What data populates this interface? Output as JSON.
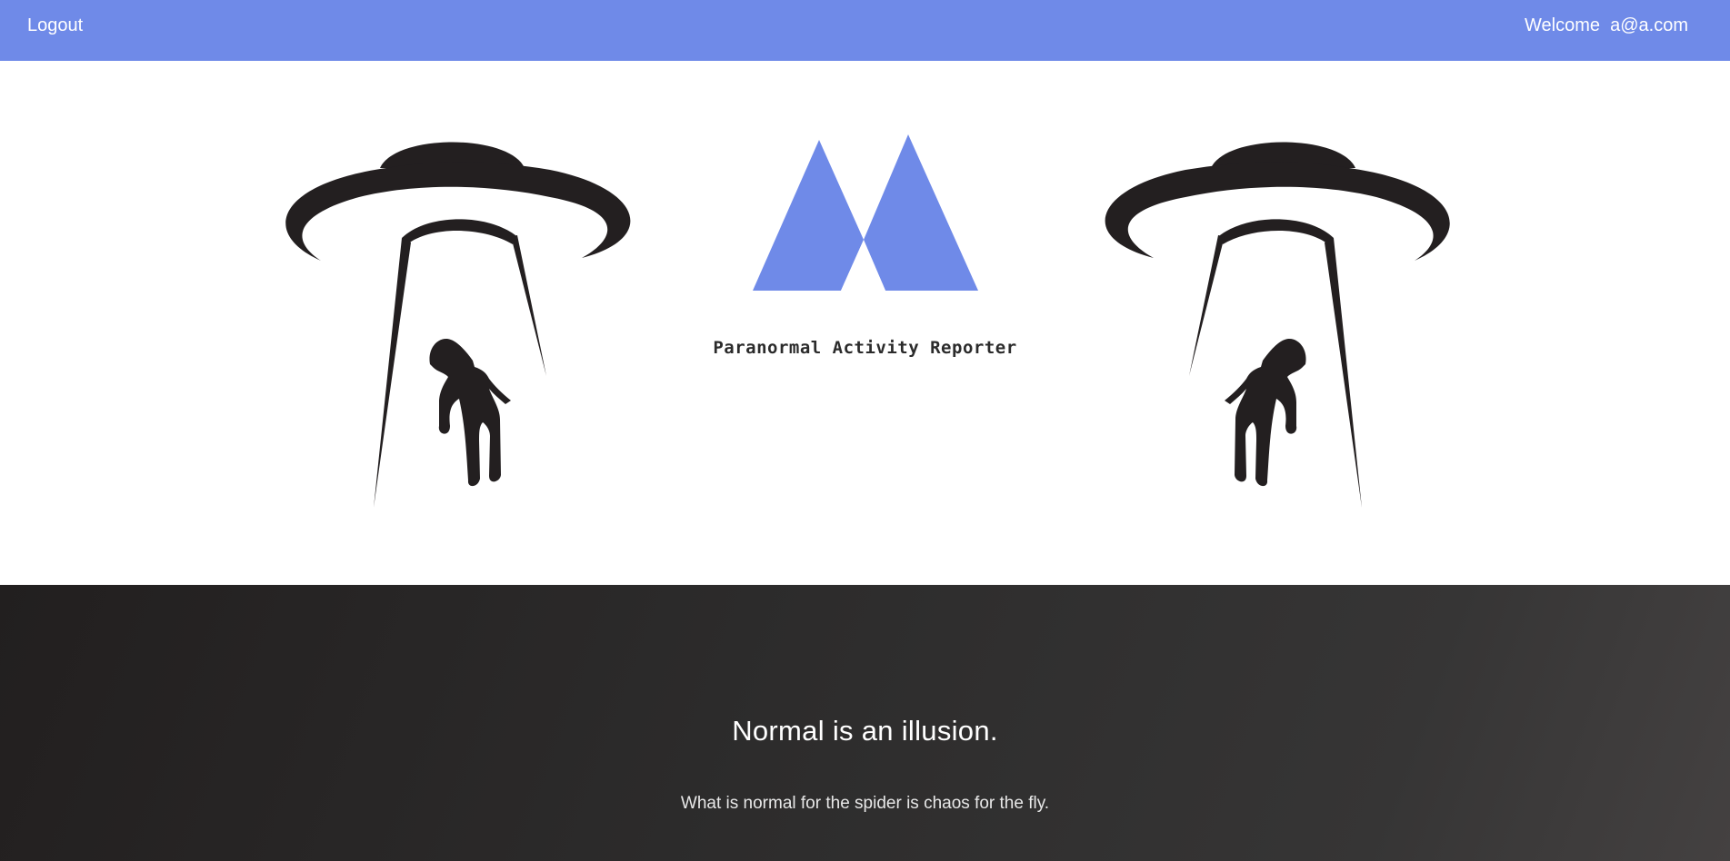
{
  "header": {
    "logout_label": "Logout",
    "welcome_text": "Welcome  a@a.com",
    "background_color": "#6f8ae8"
  },
  "hero": {
    "app_title": "Paranormal Activity Reporter",
    "logo_icon": "mountain-logo-icon",
    "left_illustration": "ufo-abduction-icon",
    "right_illustration": "ufo-abduction-icon",
    "accent_color": "#6f8ae8",
    "illustration_color": "#231f20"
  },
  "footer": {
    "headline": "Normal is an illusion.",
    "quote": "What is normal for the spider is chaos for the fly."
  }
}
